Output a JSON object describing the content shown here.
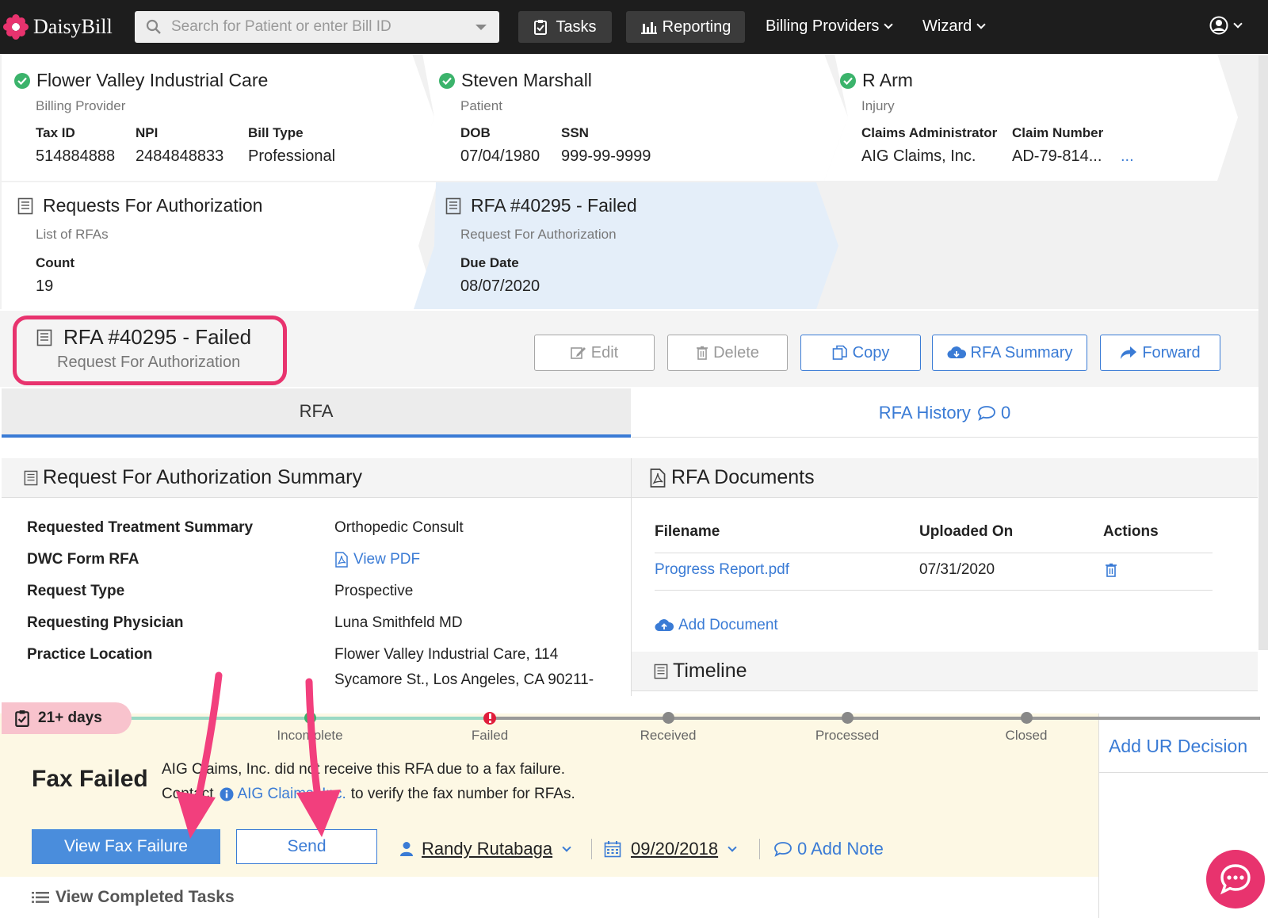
{
  "nav": {
    "brand": "DaisyBill",
    "search_placeholder": "Search for Patient or enter Bill ID",
    "tasks": "Tasks",
    "reporting": "Reporting",
    "billing_providers": "Billing Providers",
    "wizard": "Wizard"
  },
  "crumbs": {
    "provider": {
      "title": "Flower Valley Industrial Care",
      "sub": "Billing Provider",
      "tax_lbl": "Tax ID",
      "tax": "514884888",
      "npi_lbl": "NPI",
      "npi": "2484848833",
      "type_lbl": "Bill Type",
      "type": "Professional"
    },
    "patient": {
      "title": "Steven Marshall",
      "sub": "Patient",
      "dob_lbl": "DOB",
      "dob": "07/04/1980",
      "ssn_lbl": "SSN",
      "ssn": "999-99-9999"
    },
    "injury": {
      "title": "R Arm",
      "sub": "Injury",
      "admin_lbl": "Claims Administrator",
      "admin": "AIG Claims, Inc.",
      "claim_lbl": "Claim Number",
      "claim": "AD-79-814...",
      "more": "..."
    },
    "rfas": {
      "title": "Requests For Authorization",
      "sub": "List of RFAs",
      "count_lbl": "Count",
      "count": "19"
    },
    "rfa": {
      "title": "RFA #40295 - Failed",
      "sub": "Request For Authorization",
      "due_lbl": "Due Date",
      "due": "08/07/2020"
    }
  },
  "header": {
    "title": "RFA #40295 - Failed",
    "sub": "Request For Authorization",
    "edit": "Edit",
    "delete": "Delete",
    "copy": "Copy",
    "summary": "RFA Summary",
    "forward": "Forward"
  },
  "tabs": {
    "rfa": "RFA",
    "history": "RFA History",
    "history_count": "0"
  },
  "summary": {
    "title": "Request For Authorization Summary",
    "rows": [
      {
        "label": "Requested Treatment Summary",
        "value": "Orthopedic Consult"
      },
      {
        "label": "DWC Form RFA",
        "value": "View PDF"
      },
      {
        "label": "Request Type",
        "value": "Prospective"
      },
      {
        "label": "Requesting Physician",
        "value": "Luna Smithfeld MD"
      },
      {
        "label": "Practice Location",
        "value": "Flower Valley Industrial Care, 114",
        "value2": "Sycamore St., Los Angeles, CA 90211-"
      }
    ]
  },
  "documents": {
    "title": "RFA Documents",
    "headers": [
      "Filename",
      "Uploaded On",
      "Actions"
    ],
    "rows": [
      {
        "filename": "Progress Report.pdf",
        "uploaded": "07/31/2020"
      }
    ],
    "add": "Add Document"
  },
  "timeline": {
    "title": "Timeline"
  },
  "status": {
    "days": "21+ days",
    "steps": [
      "Incomplete",
      "Failed",
      "Received",
      "Processed",
      "Closed"
    ],
    "fax_title": "Fax Failed",
    "line1": "AIG Claims, Inc. did not receive this RFA due to a fax failure.",
    "line2_pre": "Contact",
    "line2_link": "AIG Claims, Inc.",
    "line2_post": "to verify the fax number for RFAs.",
    "view_fax": "View Fax Failure",
    "send": "Send",
    "user": "Randy Rutabaga",
    "date": "09/20/2018",
    "note": "0 Add Note",
    "add_ur": "Add UR Decision",
    "completed": "View Completed Tasks"
  },
  "colors": {
    "accent": "#3a7bd5",
    "highlight": "#e8336e",
    "success": "#3bb36b",
    "error": "#e01e3c"
  }
}
